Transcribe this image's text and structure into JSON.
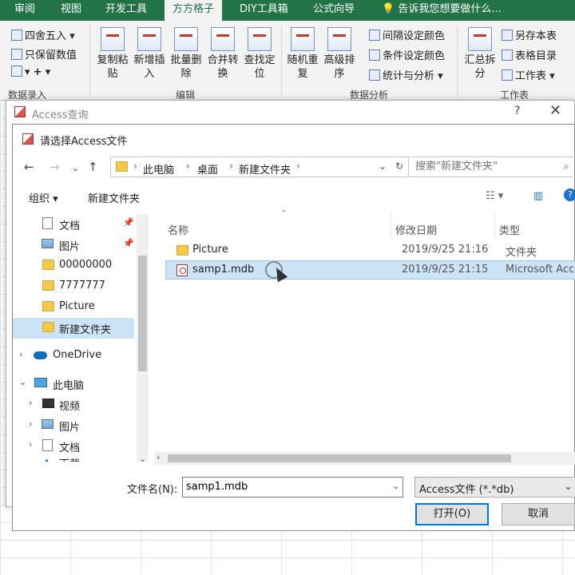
{
  "ribbon": {
    "tabs": [
      "审阅",
      "视图",
      "开发工具",
      "方方格子",
      "DIY工具箱",
      "公式向导"
    ],
    "tell_me": "告诉我您想要做什么...",
    "left_small": [
      "四舍五入",
      "只保留数值"
    ],
    "group_labels": [
      "数据录入",
      "编辑",
      "数据分析",
      "工作表"
    ],
    "big_buttons": [
      {
        "l1": "复制粘",
        "l2": "贴"
      },
      {
        "l1": "新增插",
        "l2": "入"
      },
      {
        "l1": "批量删",
        "l2": "除"
      },
      {
        "l1": "合并转",
        "l2": "换"
      },
      {
        "l1": "查找定",
        "l2": "位"
      },
      {
        "l1": "随机重",
        "l2": "复"
      },
      {
        "l1": "高级排",
        "l2": "序"
      },
      {
        "l1": "汇总拆",
        "l2": "分"
      }
    ],
    "analysis_small": [
      "间隔设定颜色",
      "条件设定颜色",
      "统计与分析"
    ],
    "sheet_small": [
      "另存本表",
      "表格目录",
      "工作表"
    ]
  },
  "outer_dialog": {
    "title": "Access查询",
    "help": "?",
    "close": "✕"
  },
  "file_dialog": {
    "title": "请选择Access文件",
    "breadcrumb": [
      "此电脑",
      "桌面",
      "新建文件夹"
    ],
    "search_placeholder": "搜索\"新建文件夹\"",
    "organize": "组织",
    "new_folder": "新建文件夹",
    "nav": {
      "quick": [
        "文档",
        "图片",
        "00000000",
        "7777777",
        "Picture",
        "新建文件夹"
      ],
      "onedrive": "OneDrive",
      "this_pc": "此电脑",
      "pc_items": [
        "视频",
        "图片",
        "文档",
        "下载"
      ]
    },
    "columns": {
      "name": "名称",
      "date": "修改日期",
      "type": "类型"
    },
    "files": [
      {
        "name": "Picture",
        "date": "2019/9/25 21:16",
        "type": "文件夹"
      },
      {
        "name": "samp1.mdb",
        "date": "2019/9/25 21:15",
        "type": "Microsoft Acce"
      }
    ],
    "filename_label": "文件名(N):",
    "filename_value": "samp1.mdb",
    "filetype": "Access文件 (*.*db)",
    "open_button": "打开(O)",
    "cancel_button": "取消"
  }
}
